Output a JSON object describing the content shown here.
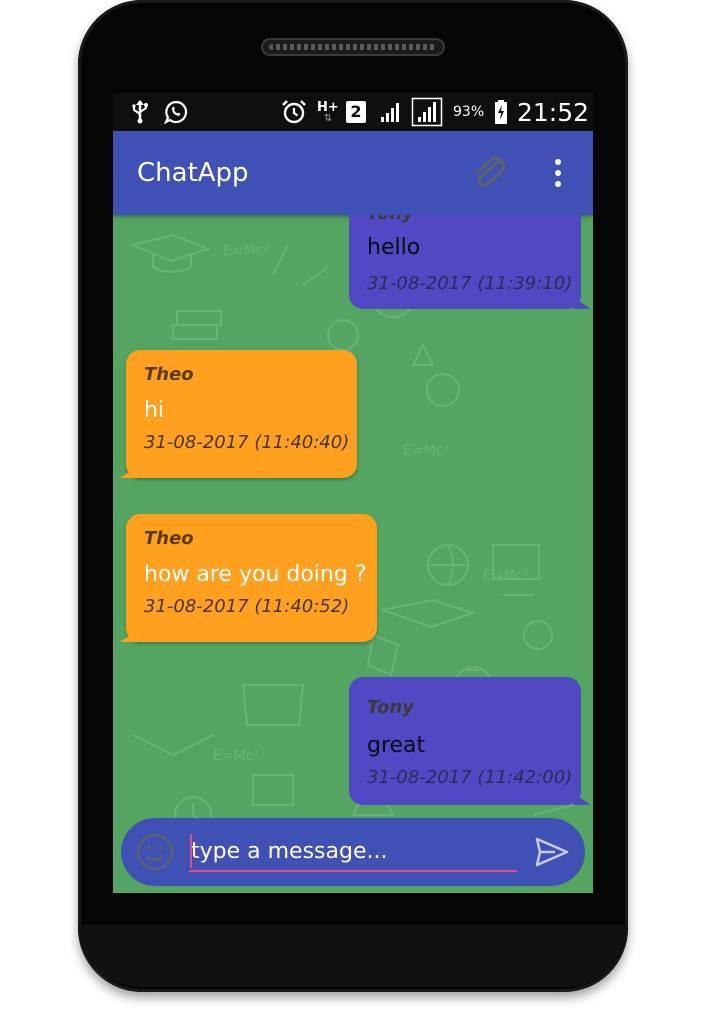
{
  "status_bar": {
    "icons": [
      "usb-icon",
      "whatsapp-icon",
      "alarm-icon",
      "network-h-plus-icon",
      "sim-2-icon",
      "signal-icon",
      "signal-boxed-icon",
      "battery-charging-icon"
    ],
    "network_type": "H+",
    "sim_slot": "2",
    "battery_percent": "93%",
    "time": "21:52"
  },
  "app_bar": {
    "title": "ChatApp",
    "actions": [
      "attach-icon",
      "overflow-menu-icon"
    ]
  },
  "messages": [
    {
      "direction": "out",
      "sender": "Tony",
      "text": "hello",
      "timestamp": "31-08-2017 (11:39:10)"
    },
    {
      "direction": "in",
      "sender": "Theo",
      "text": "hi",
      "timestamp": "31-08-2017 (11:40:40)"
    },
    {
      "direction": "in",
      "sender": "Theo",
      "text": "how are you doing ?",
      "timestamp": "31-08-2017 (11:40:52)"
    },
    {
      "direction": "out",
      "sender": "Tony",
      "text": "great",
      "timestamp": "31-08-2017 (11:42:00)"
    }
  ],
  "composer": {
    "placeholder": "type a message...",
    "value": "",
    "emoji_icon": "emoji-icon",
    "send_icon": "send-icon"
  },
  "colors": {
    "app_bar": "#3f51b5",
    "status_bar": "#0f0f0f",
    "chat_background": "#54a561",
    "incoming_bubble": "#ffa01e",
    "outgoing_bubble": "#5148c4",
    "input_underline": "#e84a83"
  }
}
